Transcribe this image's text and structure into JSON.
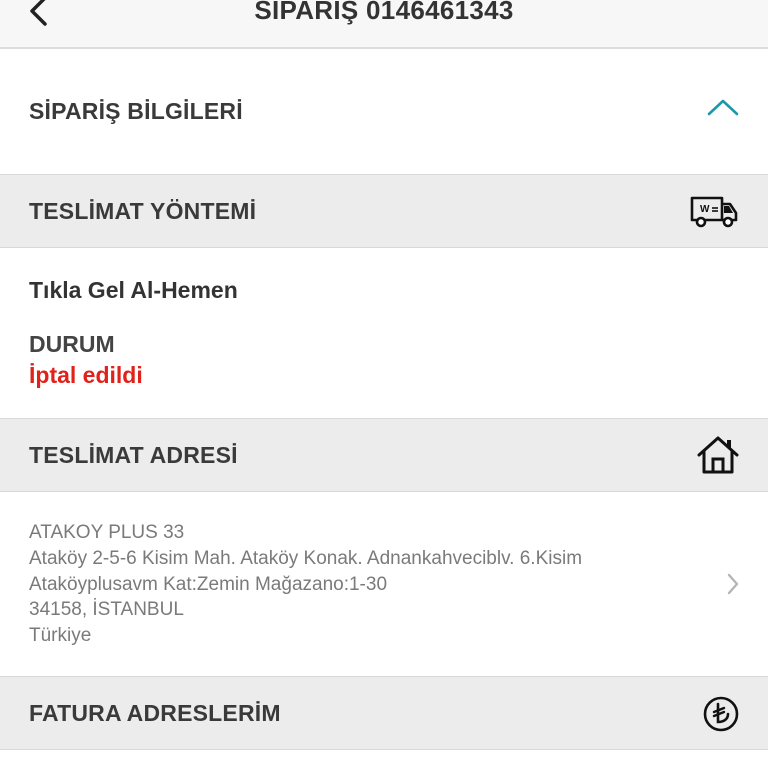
{
  "header": {
    "title": "SİPARİŞ 0146461343",
    "back_icon": "chevron-left-icon"
  },
  "order_info": {
    "title": "SİPARİŞ BİLGİLERİ",
    "toggle_icon": "chevron-up-icon",
    "accent": "#1a9aa8"
  },
  "delivery_method": {
    "title": "TESLİMAT YÖNTEMİ",
    "icon": "delivery-van-icon",
    "value": "Tıkla Gel Al-Hemen",
    "status_label": "DURUM",
    "status_value": "İptal edildi",
    "status_color": "#e0221a"
  },
  "delivery_address": {
    "title": "TESLİMAT ADRESİ",
    "icon": "home-icon",
    "lines": [
      "ATAKOY PLUS 33",
      "Ataköy 2-5-6 Kisim Mah. Ataköy Konak. Adnankahveciblv. 6.Kisim",
      "Ataköyplusavm Kat:Zemin Mağazano:1-30",
      "34158, İSTANBUL",
      "Türkiye"
    ],
    "nav_icon": "chevron-right-icon"
  },
  "billing": {
    "title": "FATURA ADRESLERİM",
    "icon": "lira-icon"
  }
}
